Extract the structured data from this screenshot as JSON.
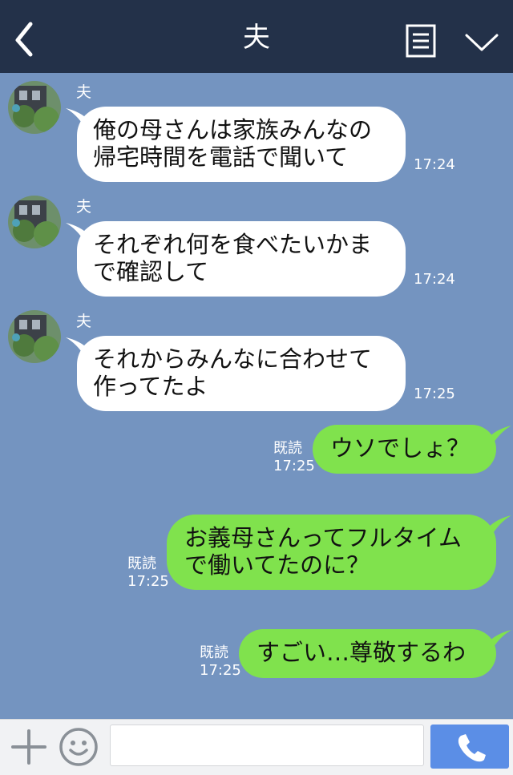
{
  "header": {
    "title": "夫",
    "back_icon": "chevron-left-icon",
    "menu_icon": "notes-icon",
    "collapse_icon": "chevron-down-icon"
  },
  "messages": [
    {
      "sender": "夫",
      "lines": [
        "俺の母さんは家族みんなの",
        "帰宅時間を電話で聞いて"
      ],
      "time": "17:24"
    },
    {
      "sender": "夫",
      "lines": [
        "それぞれ何を食べたいかま",
        "で確認して"
      ],
      "time": "17:24"
    },
    {
      "sender": "夫",
      "lines": [
        "それからみんなに合わせて",
        "作ってたよ"
      ],
      "time": "17:25"
    },
    {
      "lines": [
        "ウソでしょ？"
      ],
      "read": "既読",
      "time": "17:25"
    },
    {
      "lines": [
        "お義母さんってフルタイム",
        "で働いてたのに？"
      ],
      "read": "既読",
      "time": "17:25"
    },
    {
      "lines": [
        "すごい…尊敬するわ"
      ],
      "read": "既読",
      "time": "17:25"
    }
  ],
  "input_bar": {
    "plus_icon": "plus-icon",
    "emoji_icon": "smiley-icon",
    "text_value": "",
    "call_icon": "phone-icon"
  },
  "colors": {
    "header_bg": "#233149",
    "chat_bg": "#7494c0",
    "outgoing_bubble": "#80e24d",
    "incoming_bubble": "#ffffff",
    "call_button": "#5b8ee6"
  }
}
